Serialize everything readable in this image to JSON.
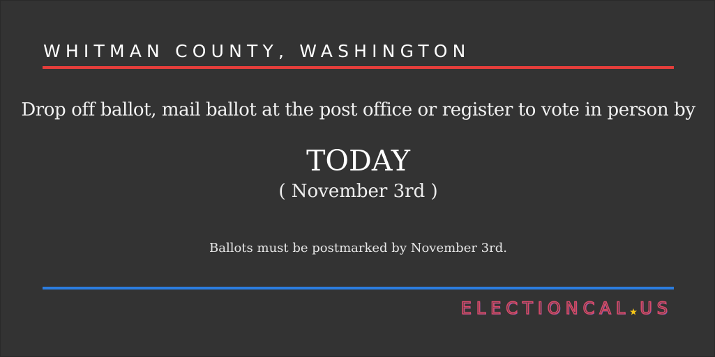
{
  "heading": "WHITMAN COUNTY, WASHINGTON",
  "instruction": "Drop off ballot, mail ballot at the post office or register to vote in person by",
  "deadline": "TODAY",
  "date": "( November 3rd )",
  "note": "Ballots must be postmarked by November 3rd.",
  "brand": {
    "name": "ELECTIONCAL",
    "tld": "US",
    "icon": "star-icon"
  },
  "colors": {
    "background": "#333333",
    "red_rule": "#e53e3b",
    "blue_rule": "#2b7de0",
    "star": "#f5c518"
  }
}
